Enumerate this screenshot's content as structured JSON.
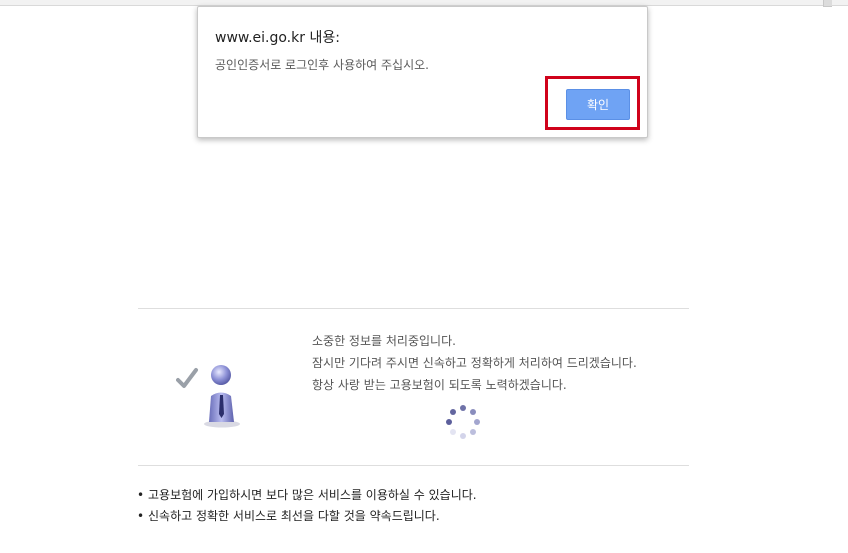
{
  "alert": {
    "title": "www.ei.go.kr 내용:",
    "message": "공인인증서로 로그인후 사용하여 주십시오.",
    "ok_label": "확인"
  },
  "notice": {
    "lines": [
      "소중한 정보를 처리중입니다.",
      "잠시만 기다려 주시면 신속하고 정확하게 처리하여 드리겠습니다.",
      "항상 사랑 받는 고용보험이 되도록 노력하겠습니다."
    ]
  },
  "footer": {
    "bullets": [
      "고용보험에 가입하시면 보다 많은 서비스를 이용하실 수 있습니다.",
      "신속하고 정확한 서비스로 최선을 다할 것을 약속드립니다."
    ]
  },
  "icons": {
    "illustration": "person-checkmark-icon",
    "spinner": "loading-spinner-icon",
    "bullet": "•"
  },
  "colors": {
    "button": "#6fa3f4",
    "highlight": "#d0021b",
    "figure": "#7b7fc4"
  }
}
